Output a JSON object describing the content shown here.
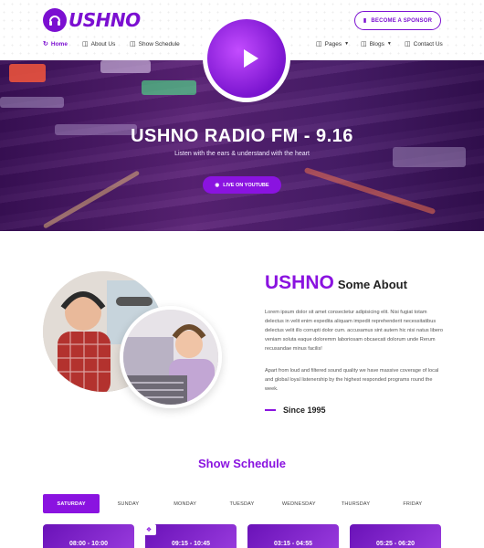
{
  "header": {
    "logo_text": "USHNO",
    "sponsor_label": "BECOME A SPONSOR",
    "nav": [
      {
        "label": "Home"
      },
      {
        "label": "About Us"
      },
      {
        "label": "Show Schedule"
      },
      {
        "label": "Pages"
      },
      {
        "label": "Blogs"
      },
      {
        "label": "Contact Us"
      }
    ]
  },
  "hero": {
    "title": "USHNO RADIO FM - 9.16",
    "subtitle": "Listen with the ears & understand with the heart",
    "button_label": "LIVE ON YOUTUBE"
  },
  "about": {
    "title_big": "USHNO",
    "title_small": "Some About",
    "paragraph1": "Lorem ipsum dolor sit amet consectetur adipisicing elit. Nisi fugiat totam delectus in velit enim expedita aliquam impedit reprehenderit necessitatibus delectus velit illo corrupti dolor cum. accusamus sint autem hic nisi natus libero veniam soluta eaque doloremm laboriosam obcaecati dolorum unde Rerum recusandae minus facilis!",
    "paragraph2": "Apart from loud and filtered sound quality we have massive coverage of local and global loyal listenership by the highest responded programs round the week.",
    "since": "Since 1995"
  },
  "schedule": {
    "title": "Show Schedule",
    "days": [
      "SATURDAY",
      "SUNDAY",
      "MONDAY",
      "TUESDAY",
      "WEDNESDAY",
      "THURSDAY",
      "FRIDAY"
    ],
    "active_day": "SATURDAY",
    "cards": [
      {
        "time": "08:00 - 10:00"
      },
      {
        "time": "09:15 - 10:45"
      },
      {
        "time": "03:15 - 04:55"
      },
      {
        "time": "05:25 - 06:20"
      }
    ]
  },
  "colors": {
    "accent": "#8a13e0",
    "brand": "#7b0fd1"
  },
  "icons": {
    "logo": "headphones-icon",
    "sponsor": "ticket-icon",
    "live": "eye-icon",
    "play": "play-icon"
  }
}
